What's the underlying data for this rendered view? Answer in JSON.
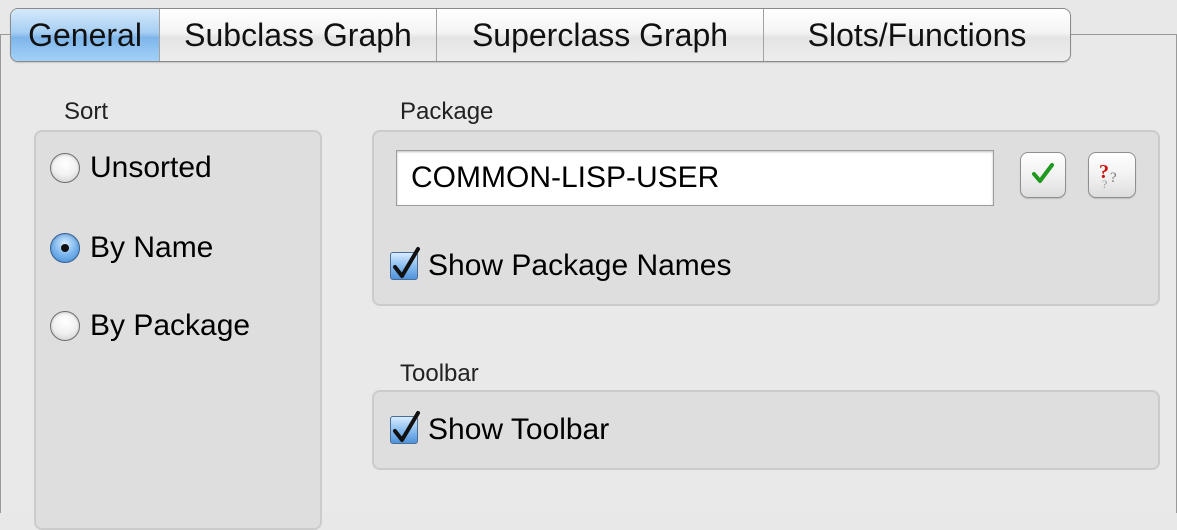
{
  "tabs": [
    {
      "label": "General",
      "selected": true
    },
    {
      "label": "Subclass Graph",
      "selected": false
    },
    {
      "label": "Superclass Graph",
      "selected": false
    },
    {
      "label": "Slots/Functions",
      "selected": false
    }
  ],
  "sort": {
    "label": "Sort",
    "options": [
      {
        "label": "Unsorted",
        "selected": false
      },
      {
        "label": "By Name",
        "selected": true
      },
      {
        "label": "By Package",
        "selected": false
      }
    ]
  },
  "package": {
    "label": "Package",
    "value": "COMMON-LISP-USER",
    "accept_icon": "checkmark-icon",
    "help_icon": "question-icon",
    "show_package_names": {
      "label": "Show Package Names",
      "checked": true
    }
  },
  "toolbar": {
    "label": "Toolbar",
    "show_toolbar": {
      "label": "Show Toolbar",
      "checked": true
    }
  },
  "colors": {
    "selected_tab": "#7fb6ea",
    "checkbox_blue": "#4f93db",
    "accept_green": "#1f9a1f",
    "help_red": "#cc1111"
  }
}
